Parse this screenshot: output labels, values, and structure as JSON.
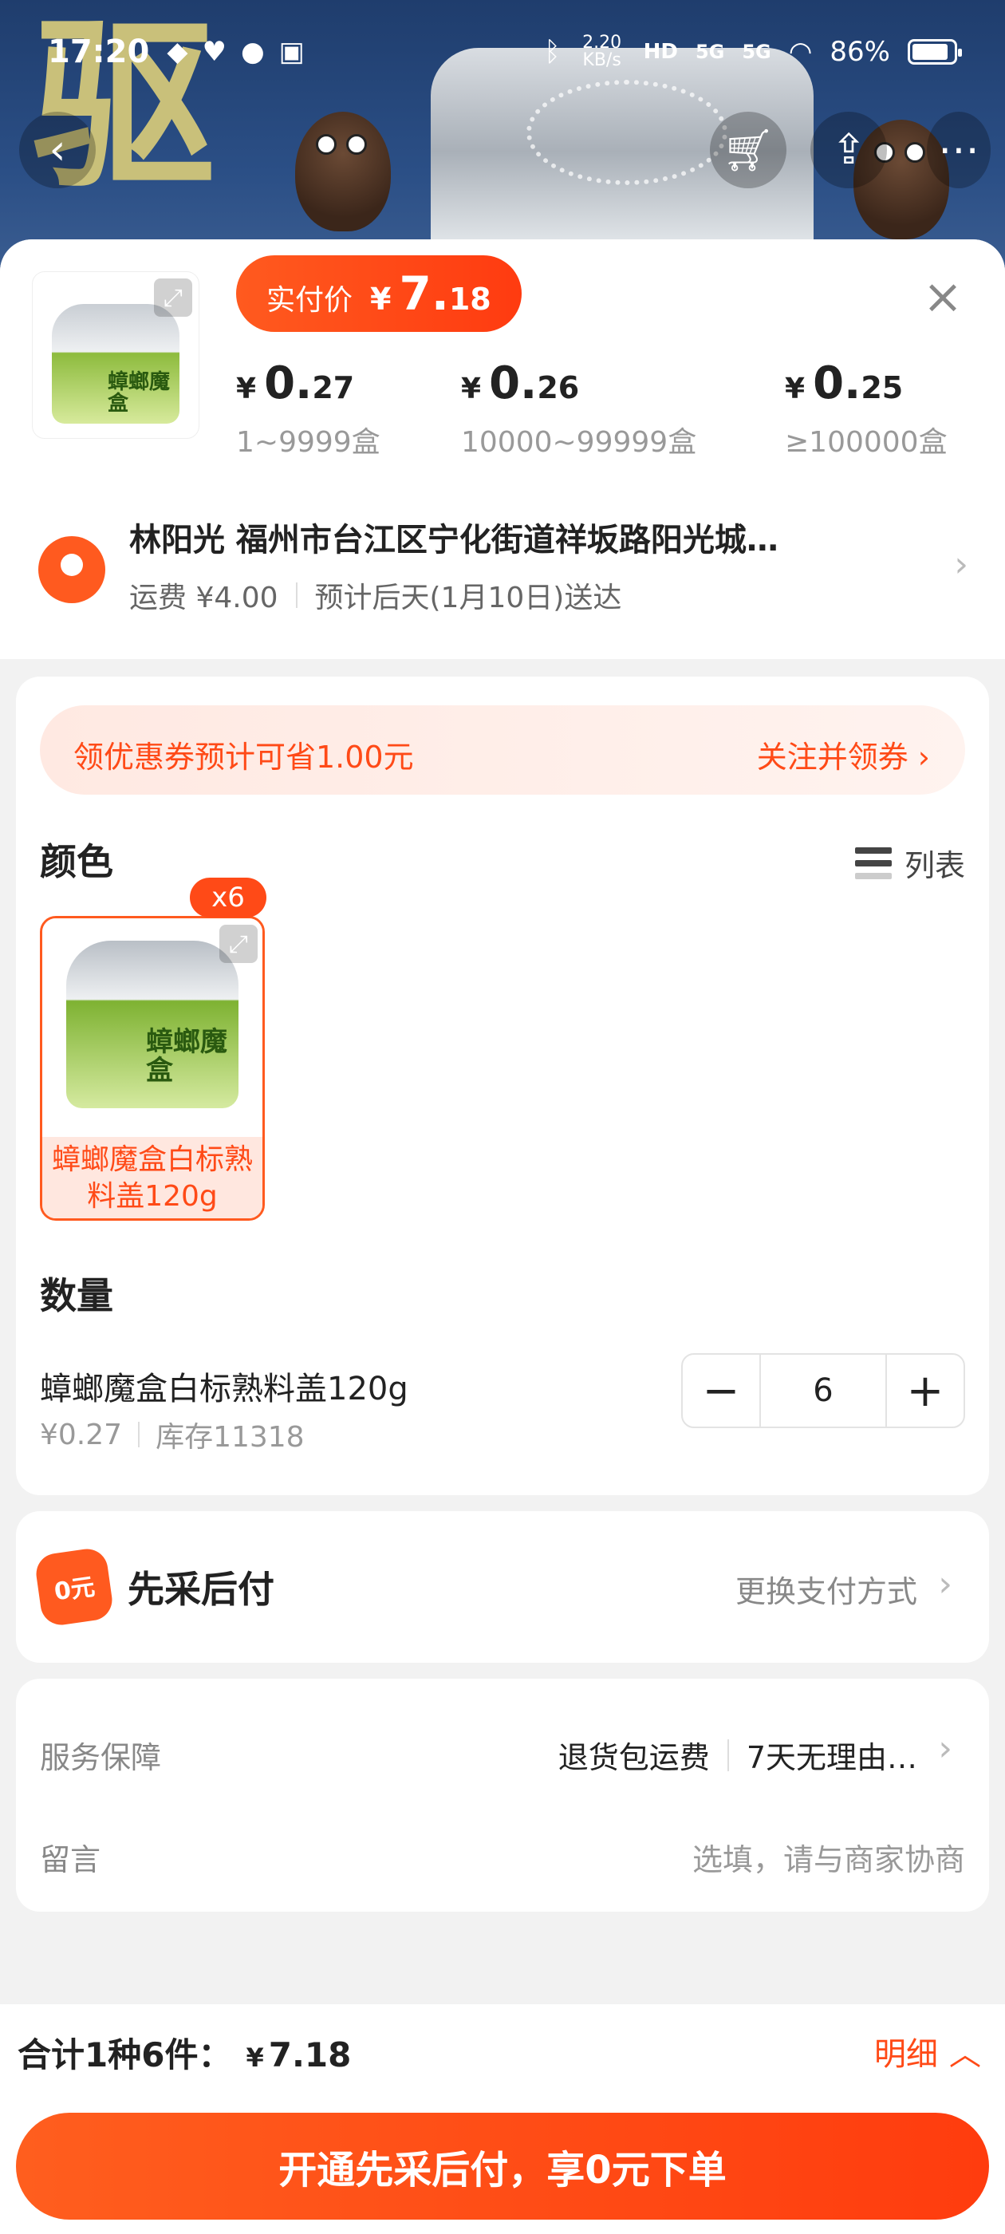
{
  "status_bar": {
    "time": "17:20",
    "net_speed": "2.20 KB/s",
    "network_labels": [
      "HD",
      "5G",
      "5G"
    ],
    "battery": "86%"
  },
  "banner": {
    "headline_char": "驱"
  },
  "header": {
    "paid_price_label": "实付价",
    "paid_price_currency": "¥",
    "paid_price_int": "7.",
    "paid_price_dec": "18",
    "tiers": [
      {
        "currency": "¥",
        "int": "0.",
        "dec": "27",
        "range": "1~9999盒"
      },
      {
        "currency": "¥",
        "int": "0.",
        "dec": "26",
        "range": "10000~99999盒"
      },
      {
        "currency": "¥",
        "int": "0.",
        "dec": "25",
        "range": "≥100000盒"
      }
    ],
    "product_thumb_label": "蟑螂魔盒"
  },
  "address": {
    "line": "林阳光 福州市台江区宁化街道祥坂路阳光城…",
    "shipping": "运费 ¥4.00",
    "eta": "预计后天(1月10日)送达"
  },
  "coupon": {
    "text": "领优惠券预计可省1.00元",
    "action": "关注并领券 ›"
  },
  "color_section": {
    "title": "颜色",
    "list_toggle": "列表",
    "option": {
      "name": "蟑螂魔盒白标熟料盖120g",
      "badge": "x6",
      "thumb_label": "蟑螂魔盒"
    }
  },
  "quantity_section": {
    "title": "数量",
    "item_name": "蟑螂魔盒白标熟料盖120g",
    "unit_price": "¥0.27",
    "stock": "库存11318",
    "value": "6",
    "minus": "−",
    "plus": "+"
  },
  "payment": {
    "title": "先采后付",
    "action": "更换支付方式",
    "icon_text": "0元"
  },
  "service": {
    "label": "服务保障",
    "tags": [
      "退货包运费",
      "7天无理由…"
    ],
    "message_label": "留言",
    "message_placeholder": "选填，请与商家协商"
  },
  "bottom": {
    "total_label": "合计1种6件：",
    "total_currency": "¥",
    "total_value": "7.18",
    "detail": "明细",
    "cta": "开通先采后付，享0元下单"
  },
  "colors": {
    "accent": "#ff4a17",
    "accent_light": "#ffe7df"
  }
}
